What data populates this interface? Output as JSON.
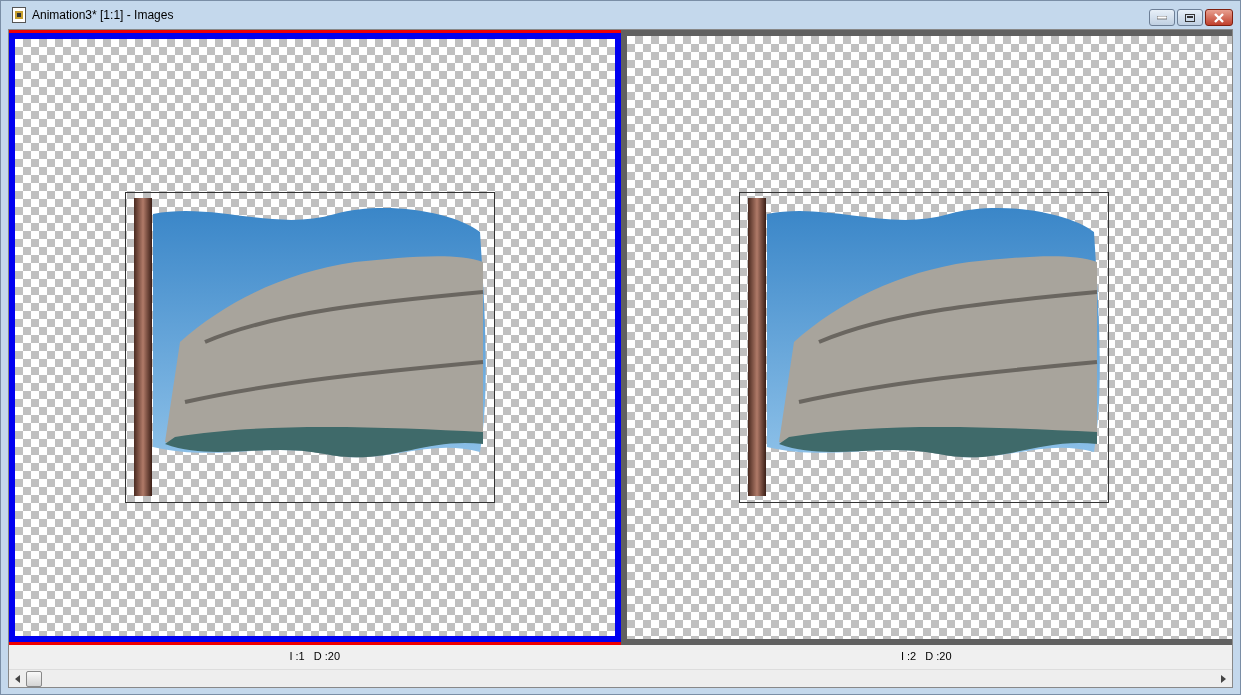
{
  "window": {
    "title": "Animation3* [1:1] - Images"
  },
  "frames": [
    {
      "selected": true,
      "index": "I :1",
      "delay": "D :20"
    },
    {
      "selected": false,
      "index": "I :2",
      "delay": "D :20"
    }
  ]
}
